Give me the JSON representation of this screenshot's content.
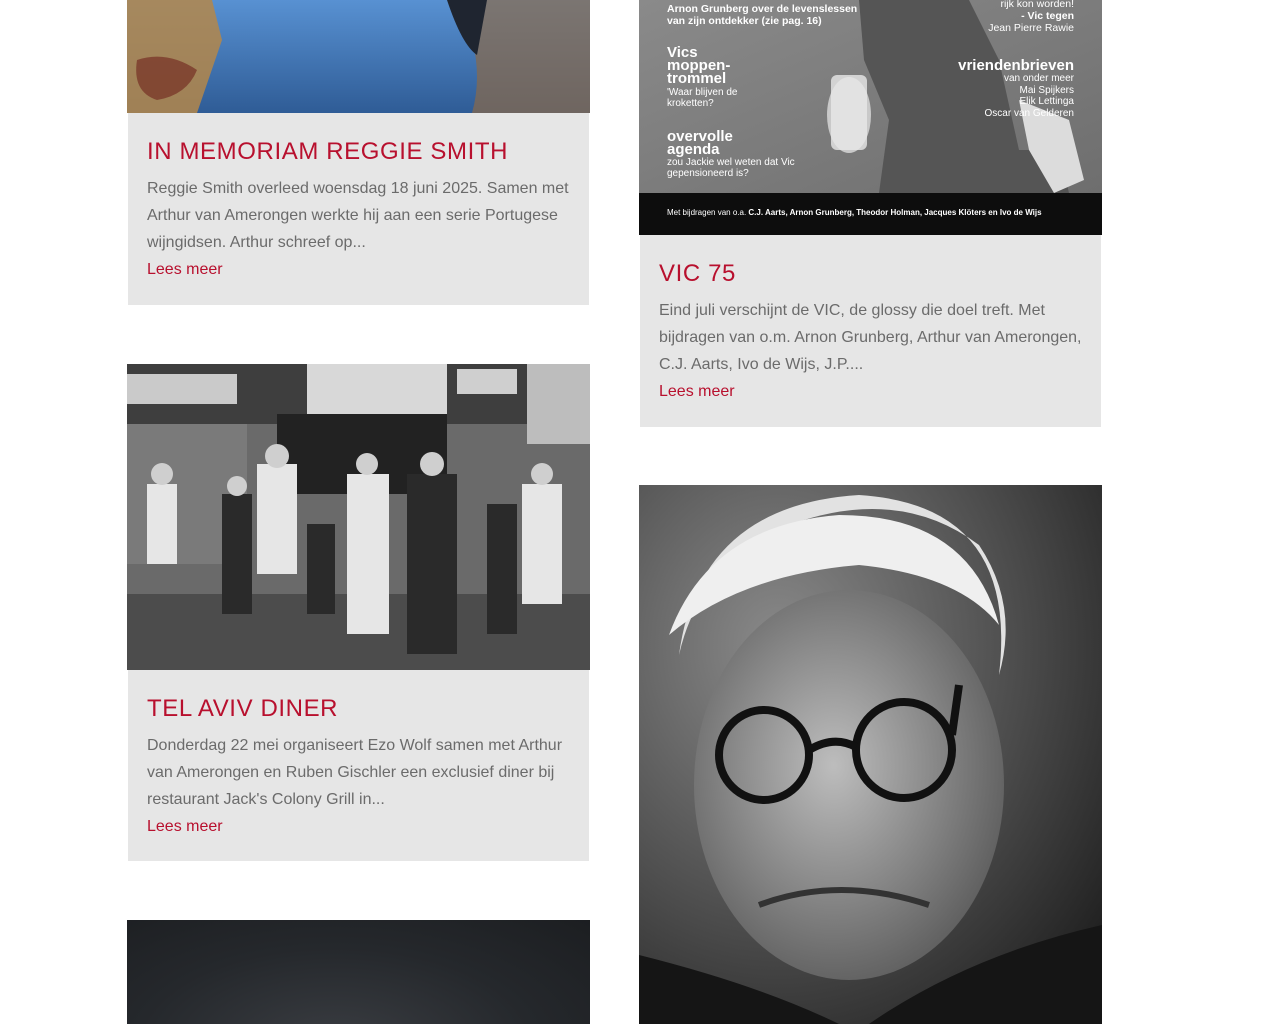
{
  "cards": [
    {
      "title": "IN MEMORIAM REGGIE SMITH",
      "excerpt": "Reggie Smith overleed woensdag 18 juni 2025. Samen met Arthur van Amerongen werkte hij aan een serie Portugese wijngidsen. Arthur schreef op...",
      "more": "Lees meer",
      "image": "dusk-water-photo"
    },
    {
      "title": "VIC 75",
      "excerpt": "Eind juli verschijnt de VIC, de glossy die doel treft. Met bijdragen van o.m. Arnon Grunberg, Arthur van Amerongen, C.J. Aarts, Ivo de Wijs, J.P....",
      "more": "Lees meer",
      "image": "vic-magazine-cover",
      "cover": {
        "top_left": "Arnon Grunberg over de levenslessen van zijn ontdekker (zie pag. 16)",
        "top_right_1": "rijk kon worden!",
        "top_right_2": "- Vic tegen",
        "top_right_3": "Jean Pierre Rawie",
        "heading_1": "Vics moppen-trommel",
        "sub_1": "'Waar blijven de kroketten?",
        "heading_2": "overvolle agenda",
        "sub_2": "zou Jackie wel weten dat Vic gepensioneerd is?",
        "heading_3": "vriendenbrieven",
        "names": [
          "van onder meer",
          "Mai Spijkers",
          "Elik Lettinga",
          "Oscar van Gelderen"
        ],
        "footer_prefix": "Met bijdragen van o.a.",
        "footer_names": "C.J. Aarts, Arnon Grunberg, Theodor Holman, Jacques Klöters en Ivo de Wijs"
      }
    },
    {
      "title": "TEL AVIV DINER",
      "excerpt": "Donderdag 22 mei organiseert Ezo Wolf samen met Arthur van Amerongen en Ruben Gischler een exclusief diner bij restaurant Jack's Colony Grill in...",
      "more": "Lees meer",
      "image": "tel-aviv-street-photo"
    },
    {
      "image": "portrait-photo"
    },
    {
      "image": "dark-photo"
    }
  ]
}
